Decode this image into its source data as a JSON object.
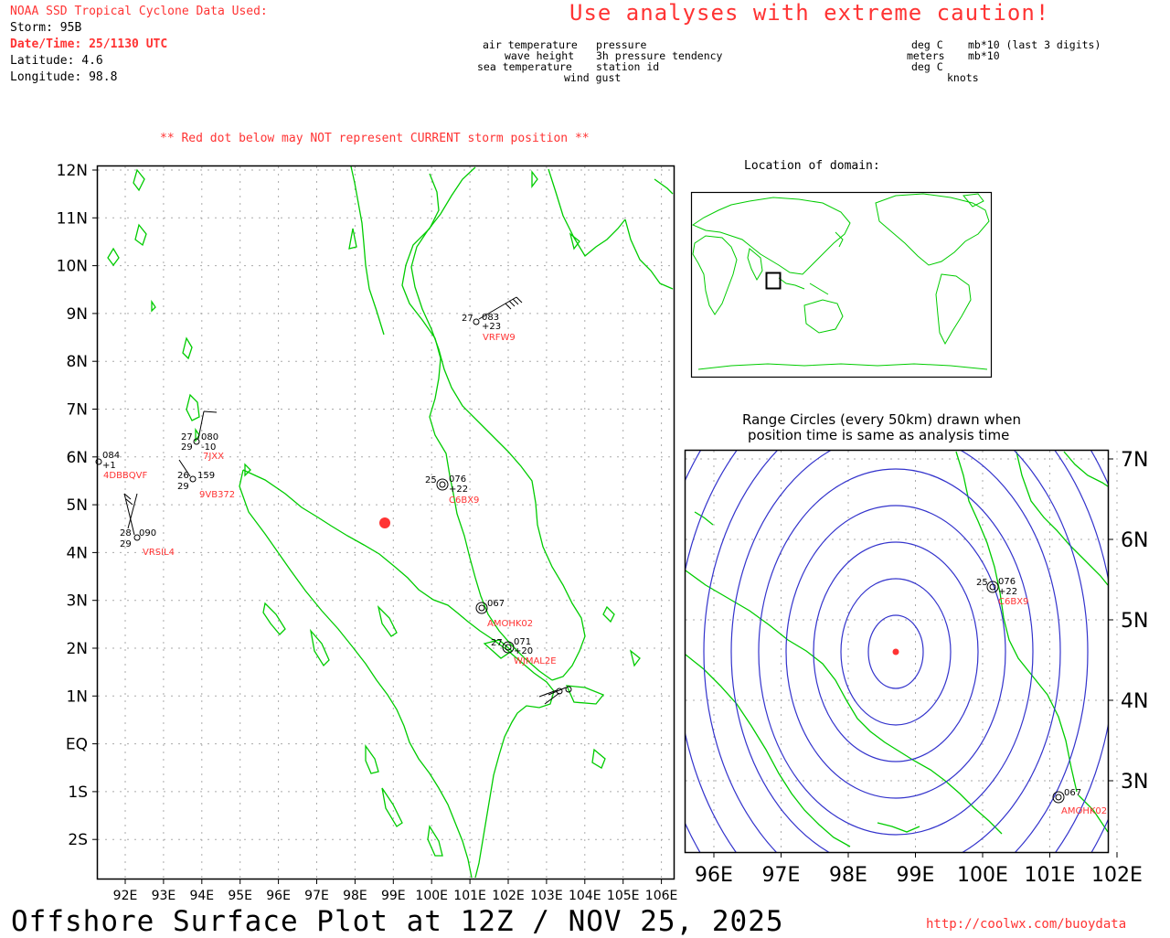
{
  "header": {
    "source": "NOAA SSD Tropical Cyclone Data Used:",
    "storm": "Storm: 95B",
    "datetime": "Date/Time: 25/1130 UTC",
    "latitude": "Latitude: 4.6",
    "longitude": "Longitude: 98.8",
    "caution": "Use analyses with extreme caution!",
    "red_dot_note": "** Red dot below may NOT represent CURRENT storm position **"
  },
  "legend": {
    "left": {
      "air_temperature": "air temperature",
      "pressure": "pressure",
      "wave_height": "wave height",
      "tendency": "3h pressure tendency",
      "sea_temperature": "sea temperature",
      "station_id": "station id",
      "wind_gust": "wind gust"
    },
    "right": {
      "deg_c_1": "deg C",
      "mb10": "mb*10 (last 3 digits)",
      "meters": "meters",
      "mb10b": "mb*10",
      "deg_c_2": "deg C",
      "knots": "knots"
    }
  },
  "main_map": {
    "lat_labels": [
      "12N",
      "11N",
      "10N",
      "9N",
      "8N",
      "7N",
      "6N",
      "5N",
      "4N",
      "3N",
      "2N",
      "1N",
      "EQ",
      "1S",
      "2S"
    ],
    "lon_labels": [
      "92E",
      "93E",
      "94E",
      "95E",
      "96E",
      "97E",
      "98E",
      "99E",
      "100E",
      "101E",
      "102E",
      "103E",
      "104E",
      "105E",
      "106E"
    ],
    "storm_position": {
      "lat": 4.6,
      "lon": 98.8
    },
    "stations": [
      {
        "id": "VRFW9",
        "air_temp": "27",
        "pressure": "083",
        "tendency": "+23"
      },
      {
        "id": "7JXX",
        "air_temp": "27",
        "pressure": "080",
        "sea_temp": "29",
        "tendency": "-10"
      },
      {
        "id": "4DBBQVF",
        "pressure": "084",
        "tendency": "+1"
      },
      {
        "id": "9VB372",
        "air_temp": "26",
        "pressure": "159",
        "sea_temp": "29"
      },
      {
        "id": "C6BX9",
        "air_temp": "25",
        "pressure": "076",
        "tendency": "+22"
      },
      {
        "id": "AMOHK02",
        "pressure": "067"
      },
      {
        "id": "WJMAL2E",
        "air_temp": "27",
        "pressure": "071",
        "tendency": "+20"
      },
      {
        "id": "VRSIL4",
        "air_temp": "28",
        "pressure": "090",
        "sea_temp": "29"
      }
    ]
  },
  "inset": {
    "title": "Location of domain:"
  },
  "range_panel": {
    "title_line1": "Range Circles (every 50km) drawn when",
    "title_line2": "position time is same as analysis time",
    "lat_labels": [
      "7N",
      "6N",
      "5N",
      "4N",
      "3N"
    ],
    "lon_labels": [
      "96E",
      "97E",
      "98E",
      "99E",
      "100E",
      "101E",
      "102E"
    ],
    "stations": [
      {
        "id": "C6BX9",
        "air_temp": "25",
        "pressure": "076",
        "tendency": "+22"
      },
      {
        "id": "AMOHK02",
        "pressure": "067"
      }
    ]
  },
  "footer": {
    "title": "Offshore Surface Plot at 12Z / NOV 25, 2025",
    "url": "http://coolwx.com/buoydata"
  },
  "colors": {
    "coast": "#00cc00",
    "accent": "#ff3333",
    "circles": "#3333cc",
    "grid": "#aaaaaa"
  }
}
